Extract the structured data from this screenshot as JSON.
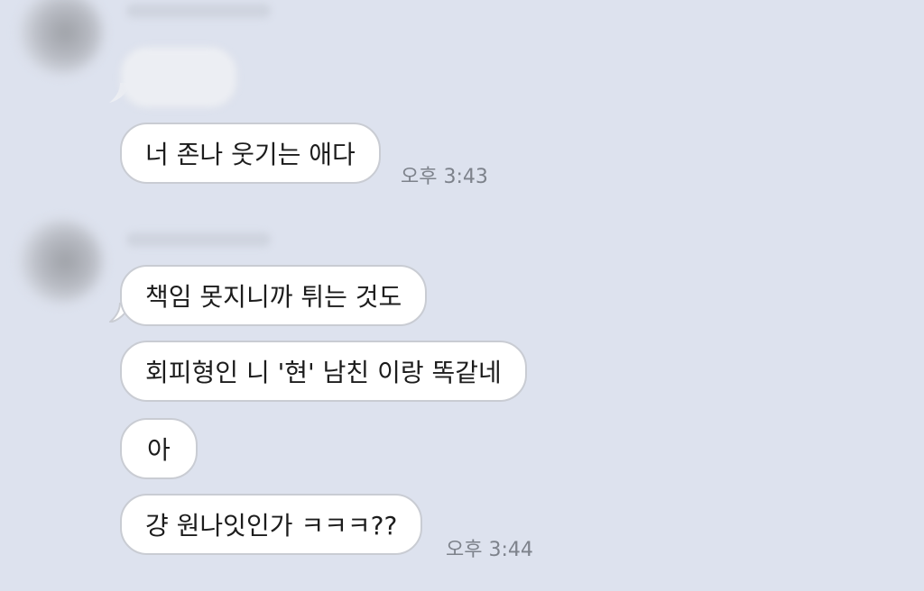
{
  "theme": {
    "background": "#dde2ee",
    "bubble_fill": "#ffffff",
    "bubble_border": "#c9ccd3",
    "time_color": "#7d828b"
  },
  "messages": [
    {
      "text": "너 존나 웃기는 애다"
    },
    {
      "text": "책임 못지니까 튀는 것도"
    },
    {
      "text": "회피형인 니 '현' 남친 이랑 똑같네"
    },
    {
      "text": "아"
    },
    {
      "text": "걍 원나잇인가 ㅋㅋㅋ??"
    }
  ],
  "timestamps": {
    "first": "오후 3:43",
    "second": "오후 3:44"
  }
}
